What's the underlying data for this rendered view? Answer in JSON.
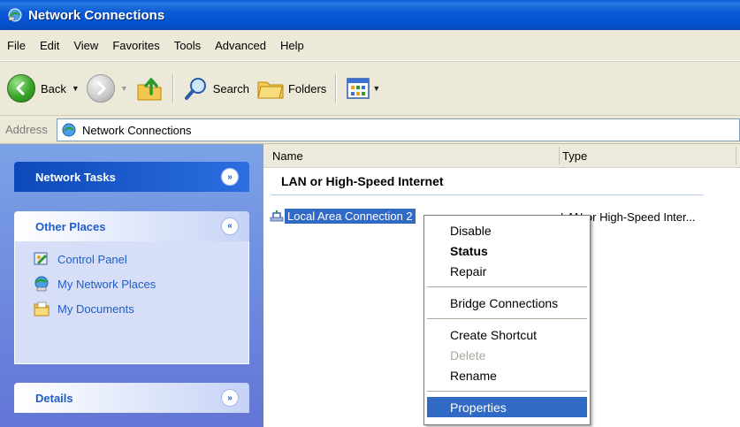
{
  "window": {
    "title": "Network Connections"
  },
  "menu": [
    "File",
    "Edit",
    "View",
    "Favorites",
    "Tools",
    "Advanced",
    "Help"
  ],
  "toolbar": {
    "back_label": "Back",
    "search_label": "Search",
    "folders_label": "Folders"
  },
  "address": {
    "label": "Address",
    "value": "Network Connections"
  },
  "sidebar": {
    "network_tasks": {
      "title": "Network Tasks"
    },
    "other_places": {
      "title": "Other Places",
      "items": [
        {
          "label": "Control Panel",
          "icon": "control-panel-icon"
        },
        {
          "label": "My Network Places",
          "icon": "network-places-icon"
        },
        {
          "label": "My Documents",
          "icon": "my-documents-icon"
        }
      ]
    },
    "details": {
      "title": "Details"
    }
  },
  "list": {
    "columns": [
      "Name",
      "Type"
    ],
    "group": "LAN or High-Speed Internet",
    "items": [
      {
        "name": "Local Area Connection 2",
        "type": "LAN or High-Speed Inter..."
      }
    ]
  },
  "context_menu": {
    "items": [
      {
        "label": "Disable"
      },
      {
        "label": "Status"
      },
      {
        "label": "Repair"
      },
      {
        "label": "Bridge Connections"
      },
      {
        "label": "Create Shortcut"
      },
      {
        "label": "Delete"
      },
      {
        "label": "Rename"
      },
      {
        "label": "Properties"
      }
    ]
  },
  "colors": {
    "title_bar": "#0a5fd8",
    "selection": "#316ac5",
    "task_pane": "#6375d6",
    "link": "#215dc6"
  }
}
